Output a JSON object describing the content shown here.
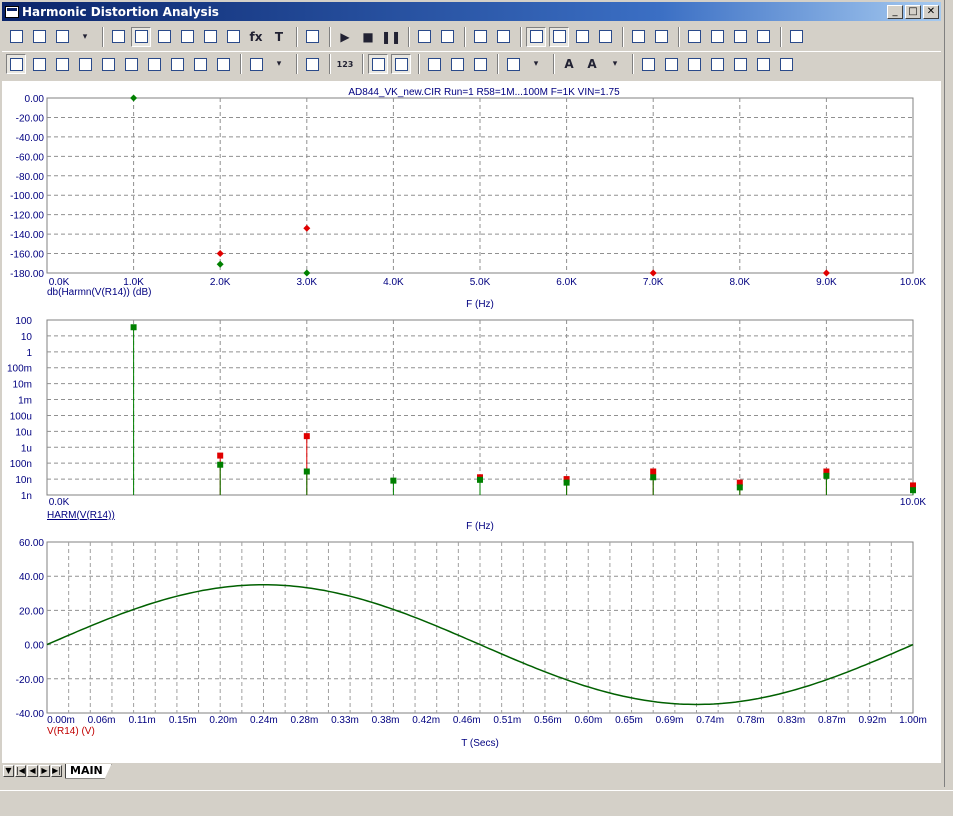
{
  "window": {
    "title": "Harmonic Distortion Analysis"
  },
  "title_buttons": {
    "minimize": "_",
    "restore": "□",
    "close": "✕"
  },
  "toolbar1": [
    {
      "icon": "pointer-icon"
    },
    {
      "icon": "pan-hand-icon"
    },
    {
      "icon": "help-icon"
    },
    {
      "icon": "dropdown-icon"
    },
    {
      "icon": "graph-icon"
    },
    {
      "icon": "scale-icon",
      "pressed": true
    },
    {
      "icon": "maximize-icon"
    },
    {
      "icon": "cursor-icon"
    },
    {
      "icon": "cursor-left-icon"
    },
    {
      "icon": "cursor-right-icon"
    },
    {
      "icon": "formula-icon",
      "text": "fx"
    },
    {
      "icon": "text-icon",
      "text": "T"
    },
    {
      "icon": "print-icon"
    },
    {
      "icon": "run-icon",
      "text": "▶"
    },
    {
      "icon": "stop-icon",
      "text": "■"
    },
    {
      "icon": "pause-icon",
      "text": "❚❚"
    },
    {
      "icon": "trace-icon"
    },
    {
      "icon": "trace2-icon"
    },
    {
      "icon": "frame-icon"
    },
    {
      "icon": "grid-icon"
    },
    {
      "icon": "layout1-icon",
      "pressed": true
    },
    {
      "icon": "layout2-icon",
      "pressed": true
    },
    {
      "icon": "layout3-icon"
    },
    {
      "icon": "layout4-icon"
    },
    {
      "icon": "hline-icon"
    },
    {
      "icon": "hgrid-icon"
    },
    {
      "icon": "x-marker-icon"
    },
    {
      "icon": "y-marker-icon"
    },
    {
      "icon": "fx-marker-icon"
    },
    {
      "icon": "probe-icon"
    },
    {
      "icon": "properties-icon"
    }
  ],
  "toolbar2": [
    {
      "icon": "fit-icon",
      "pressed": true
    },
    {
      "icon": "fit2-icon"
    },
    {
      "icon": "peak-icon"
    },
    {
      "icon": "valley-icon"
    },
    {
      "icon": "high-icon"
    },
    {
      "icon": "low-icon"
    },
    {
      "icon": "slope-icon"
    },
    {
      "icon": "inflect-icon"
    },
    {
      "icon": "global-high-icon"
    },
    {
      "icon": "global-low-icon"
    },
    {
      "icon": "clipboard-icon"
    },
    {
      "icon": "dropdown-icon"
    },
    {
      "icon": "list-icon"
    },
    {
      "icon": "data-point-icon",
      "text": "123"
    },
    {
      "icon": "zoom-fit-icon",
      "pressed": true
    },
    {
      "icon": "zoom-fit2-icon",
      "pressed": true
    },
    {
      "icon": "zoom-in-icon"
    },
    {
      "icon": "zoom-out-icon"
    },
    {
      "icon": "zoom-100-icon"
    },
    {
      "icon": "grid-select-icon"
    },
    {
      "icon": "dropdown-icon"
    },
    {
      "icon": "font-icon",
      "text": "A"
    },
    {
      "icon": "font-style-icon",
      "text": "A"
    },
    {
      "icon": "dropdown-icon"
    },
    {
      "icon": "bring-front-icon"
    },
    {
      "icon": "align-left-icon"
    },
    {
      "icon": "align-center-icon"
    },
    {
      "icon": "align-right-icon"
    },
    {
      "icon": "align-top-icon"
    },
    {
      "icon": "align-middle-icon"
    },
    {
      "icon": "align-bottom-icon"
    }
  ],
  "plot_header": "AD844_VK_new.CIR Run=1 R58=1M...100M F=1K VIN=1.75",
  "chart_data": [
    {
      "type": "scatter",
      "ylabel": "db(Harmn(V(R14)) (dB)",
      "xlabel": "F (Hz)",
      "xlim": [
        0,
        10000
      ],
      "ylim": [
        -180,
        0
      ],
      "x_ticks": [
        "0.0K",
        "1.0K",
        "2.0K",
        "3.0K",
        "4.0K",
        "5.0K",
        "6.0K",
        "7.0K",
        "8.0K",
        "9.0K",
        "10.0K"
      ],
      "y_ticks": [
        "0.00",
        "-20.00",
        "-40.00",
        "-60.00",
        "-80.00",
        "-100.00",
        "-120.00",
        "-140.00",
        "-160.00",
        "-180.00"
      ],
      "grid": true,
      "series": [
        {
          "color": "#008000",
          "x": [
            1000,
            2000,
            3000
          ],
          "values": [
            0,
            -171,
            -180
          ]
        },
        {
          "color": "#e00000",
          "x": [
            2000,
            3000,
            7000,
            9000
          ],
          "values": [
            -160,
            -134,
            -180,
            -180
          ]
        }
      ]
    },
    {
      "type": "bar",
      "ylabel": "HARM(V(R14))",
      "xlabel": "F (Hz)",
      "xlim": [
        0,
        10000
      ],
      "y_scale": "log",
      "ylim": [
        1e-09,
        100
      ],
      "x_ticks": [
        "0.0K",
        "10.0K"
      ],
      "y_ticks": [
        "100",
        "10",
        "1",
        "100m",
        "10m",
        "1m",
        "100u",
        "10u",
        "1u",
        "100n",
        "10n",
        "1n"
      ],
      "grid": true,
      "series": [
        {
          "color": "#008000",
          "x": [
            1000,
            2000,
            3000,
            4000,
            5000,
            6000,
            7000,
            8000,
            9000,
            10000
          ],
          "values": [
            35,
            8e-08,
            3e-08,
            8e-09,
            9e-09,
            6e-09,
            1.3e-08,
            3e-09,
            1.6e-08,
            2e-09
          ]
        },
        {
          "color": "#e00000",
          "x": [
            2000,
            3000,
            5000,
            6000,
            7000,
            8000,
            9000,
            10000
          ],
          "values": [
            3e-07,
            5e-06,
            1.3e-08,
            1e-08,
            3e-08,
            6e-09,
            3e-08,
            4e-09
          ]
        }
      ]
    },
    {
      "type": "line",
      "ylabel": "V(R14) (V)",
      "xlabel": "T (Secs)",
      "xlim": [
        0,
        1.0
      ],
      "ylim": [
        -40,
        60
      ],
      "x_ticks": [
        "0.00m",
        "0.06m",
        "0.11m",
        "0.15m",
        "0.20m",
        "0.24m",
        "0.28m",
        "0.33m",
        "0.38m",
        "0.42m",
        "0.46m",
        "0.51m",
        "0.56m",
        "0.60m",
        "0.65m",
        "0.69m",
        "0.74m",
        "0.78m",
        "0.83m",
        "0.87m",
        "0.92m",
        "1.00m"
      ],
      "y_ticks": [
        "60.00",
        "40.00",
        "20.00",
        "0.00",
        "-20.00",
        "-40.00"
      ],
      "grid": true,
      "series": [
        {
          "color": "#006000",
          "amplitude": 35,
          "frequency_hz": 1000
        }
      ]
    }
  ],
  "tabs": {
    "nav": [
      "▼",
      "|◀",
      "◀",
      "▶",
      "▶|"
    ],
    "active": "MAIN"
  }
}
